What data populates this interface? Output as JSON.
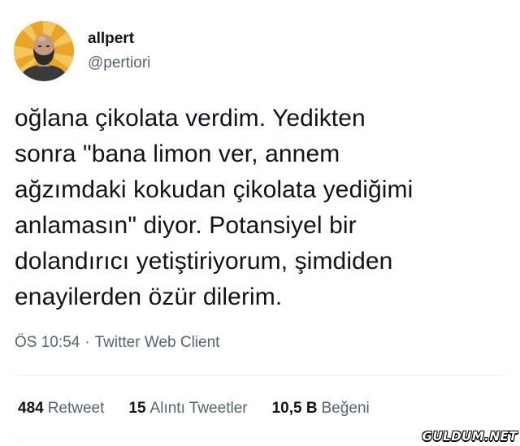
{
  "user": {
    "display_name": "allpert",
    "handle": "@pertiori",
    "avatar": "avatar-icon"
  },
  "tweet": {
    "text_lines": [
      "oğlana çikolata verdim. Yedikten",
      "sonra \"bana limon ver, annem",
      "ağzımdaki kokudan çikolata yediğimi",
      "anlamasın\" diyor. Potansiyel bir",
      "dolandırıcı yetiştiriyorum, şimdiden",
      "enayilerden özür dilerim."
    ],
    "time": "ÖS 10:54",
    "separator": "·",
    "source": "Twitter Web Client"
  },
  "stats": {
    "retweets": {
      "count": "484",
      "label": "Retweet"
    },
    "quotes": {
      "count": "15",
      "label": "Alıntı Tweetler"
    },
    "likes": {
      "count": "10,5 B",
      "label": "Beğeni"
    }
  },
  "watermark": "GULDUM.NET",
  "colors": {
    "text_primary": "#0f1419",
    "text_secondary": "#536471",
    "divider": "#eff3f4",
    "avatar_background": "#e8a52a"
  }
}
